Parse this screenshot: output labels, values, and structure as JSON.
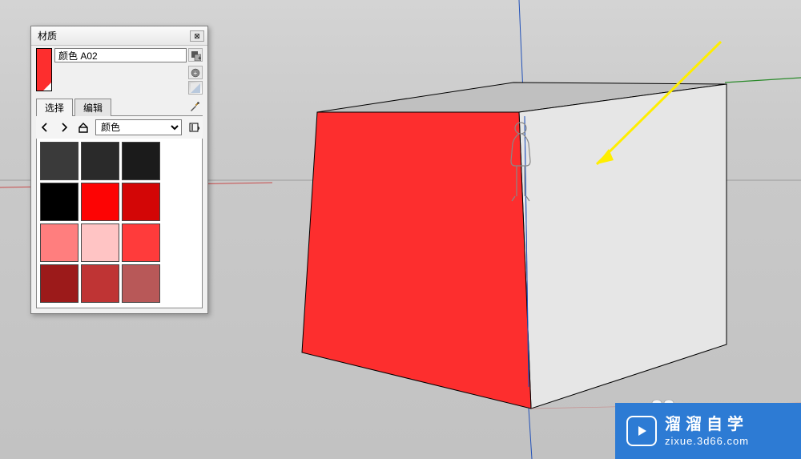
{
  "panel": {
    "title": "材质",
    "close_glyph": "⊠",
    "material_name": "颜色 A02",
    "preview_color": "#fd2e2e",
    "tool_create": "create-material-icon",
    "tool_default": "default-material-icon",
    "tabs": {
      "select": "选择",
      "edit": "编辑"
    },
    "nav": {
      "back": "←",
      "forward": "→",
      "home": "⌂"
    },
    "category_value": "颜色",
    "swatches": [
      "#3a3a3a",
      "#2a2a2a",
      "#1b1b1b",
      "#000000",
      "#fd0404",
      "#d30606",
      "#ff7e7e",
      "#ffc4c4",
      "#ff3b3b",
      "#9c1a1a",
      "#bf3434",
      "#b85858"
    ]
  },
  "watermark": {
    "line1": "溜溜自学",
    "line2": "zixue.3d66.com"
  }
}
